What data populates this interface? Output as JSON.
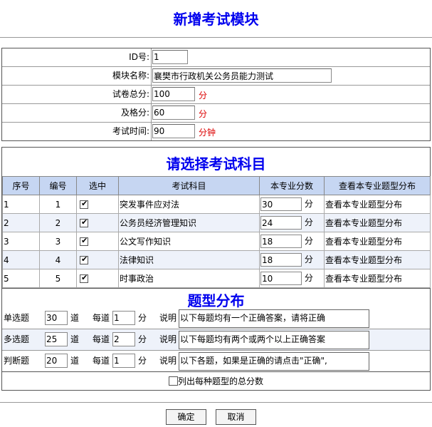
{
  "page_title": "新增考试模块",
  "info": {
    "id_label": "ID号:",
    "id_value": "1",
    "name_label": "模块名称:",
    "name_value": "襄樊市行政机关公务员能力测试",
    "total_label": "试卷总分:",
    "total_value": "100",
    "total_unit": "分",
    "pass_label": "及格分:",
    "pass_value": "60",
    "pass_unit": "分",
    "time_label": "考试时间:",
    "time_value": "90",
    "time_unit": "分钟"
  },
  "subjects": {
    "title": "请选择考试科目",
    "headers": [
      "序号",
      "编号",
      "选中",
      "考试科目",
      "本专业分数",
      "查看本专业题型分布"
    ],
    "unit": "分",
    "rows": [
      {
        "seq": "1",
        "code": "1",
        "checked": true,
        "name": "突发事件应对法",
        "score": "30",
        "link": "查看本专业题型分布"
      },
      {
        "seq": "2",
        "code": "2",
        "checked": true,
        "name": "公务员经济管理知识",
        "score": "24",
        "link": "查看本专业题型分布"
      },
      {
        "seq": "3",
        "code": "3",
        "checked": true,
        "name": "公文写作知识",
        "score": "18",
        "link": "查看本专业题型分布"
      },
      {
        "seq": "4",
        "code": "4",
        "checked": true,
        "name": "法律知识",
        "score": "18",
        "link": "查看本专业题型分布"
      },
      {
        "seq": "5",
        "code": "5",
        "checked": true,
        "name": "时事政治",
        "score": "10",
        "link": "查看本专业题型分布"
      }
    ]
  },
  "qtypes": {
    "title": "题型分布",
    "count_unit": "道",
    "per_label": "每道",
    "score_unit": "分",
    "desc_label": "说明",
    "rows": [
      {
        "name": "单选题",
        "count": "30",
        "per": "1",
        "desc": "以下每题均有一个正确答案，请将正确"
      },
      {
        "name": "多选题",
        "count": "25",
        "per": "2",
        "desc": "以下每题均有两个或两个以上正确答案"
      },
      {
        "name": "判断题",
        "count": "20",
        "per": "1",
        "desc": "以下各题，如果是正确的请点击\"正确\","
      }
    ],
    "total_label": "列出每种题型的总分数"
  },
  "buttons": {
    "ok": "确定",
    "cancel": "取消"
  }
}
